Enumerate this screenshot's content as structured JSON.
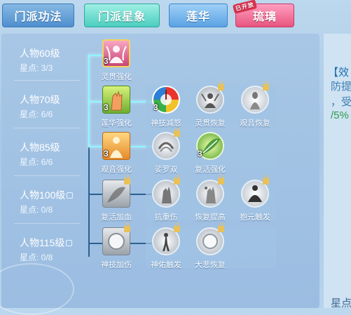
{
  "tabs": [
    {
      "label": "门派功法"
    },
    {
      "label": "门派星象"
    },
    {
      "label": "莲华"
    },
    {
      "label": "琉璃",
      "badge": "已开放"
    }
  ],
  "side_text": {
    "line1": "【效",
    "line2": "防提",
    "line3": "，受",
    "line4": "/5%",
    "bottom": "星点"
  },
  "levels": [
    {
      "title": "人物60级",
      "stars": "星点: 3/3",
      "locked": false
    },
    {
      "title": "人物70级",
      "stars": "星点: 6/6",
      "locked": false
    },
    {
      "title": "人物85级",
      "stars": "星点: 6/6",
      "locked": false
    },
    {
      "title": "人物100级",
      "stars": "星点: 0/8",
      "locked": true
    },
    {
      "title": "人物115级",
      "stars": "星点: 0/8",
      "locked": true
    }
  ],
  "skills": {
    "row1": [
      {
        "name": "灵贯强化",
        "count": "3",
        "icon": "meditating-monk-pink-icon"
      }
    ],
    "row2": [
      {
        "name": "莲华强化",
        "count": "3",
        "icon": "lotus-hand-icon"
      },
      {
        "name": "神技减怒",
        "count": "3",
        "icon": "rage-gauge-icon"
      },
      {
        "name": "灵贯恢复",
        "icon": "spirit-restore-icon",
        "locked": true
      },
      {
        "name": "观音恢复",
        "icon": "guanyin-restore-icon",
        "locked": true
      }
    ],
    "row3": [
      {
        "name": "观音强化",
        "count": "3",
        "icon": "guanyin-icon"
      },
      {
        "name": "娑罗双",
        "icon": "twin-sala-icon",
        "locked": true
      },
      {
        "name": "复活强化",
        "count": "3",
        "icon": "revive-leaf-icon"
      }
    ],
    "row4": [
      {
        "name": "复活加血",
        "icon": "revive-heal-icon",
        "locked": true
      },
      {
        "name": "抗重伤",
        "icon": "resist-injury-icon",
        "locked": true
      },
      {
        "name": "恢复提高",
        "icon": "heal-boost-icon",
        "locked": true
      },
      {
        "name": "抱元触发",
        "icon": "meditation-trigger-icon",
        "locked": true
      }
    ],
    "row5": [
      {
        "name": "神技加伤",
        "icon": "pearl-icon",
        "locked": true
      },
      {
        "name": "神佑触发",
        "icon": "divine-figure-icon",
        "locked": true
      },
      {
        "name": "大悲恢复",
        "icon": "pearl-restore-icon",
        "locked": true
      }
    ]
  }
}
